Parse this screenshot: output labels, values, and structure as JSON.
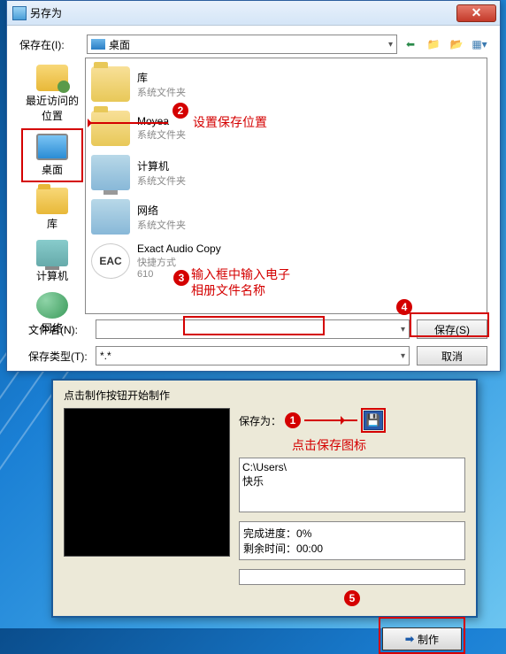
{
  "dialog": {
    "title": "另存为",
    "save_in_label": "保存在(I):",
    "location": "桌面",
    "places": [
      {
        "label": "最近访问的位置"
      },
      {
        "label": "桌面"
      },
      {
        "label": "库"
      },
      {
        "label": "计算机"
      },
      {
        "label": "网络"
      }
    ],
    "items": [
      {
        "name": "库",
        "type": "系统文件夹"
      },
      {
        "name": "Moyea",
        "type": "系统文件夹"
      },
      {
        "name": "计算机",
        "type": "系统文件夹"
      },
      {
        "name": "网络",
        "type": "系统文件夹"
      },
      {
        "name": "Exact Audio Copy",
        "type": "快捷方式",
        "size": "610"
      }
    ],
    "filename_label": "文件名(N):",
    "filename_value": "",
    "filetype_label": "保存类型(T):",
    "filetype_value": "*.*",
    "save_btn": "保存(S)",
    "cancel_btn": "取消"
  },
  "annotations": {
    "a1": "点击保存图标",
    "a2": "设置保存位置",
    "a3_line1": "输入框中输入电子",
    "a3_line2": "相册文件名称",
    "eac": "EAC"
  },
  "lower": {
    "title": "点击制作按钮开始制作",
    "saveas_label": "保存为：",
    "path_line1": "C:\\Users\\",
    "path_line2": "快乐",
    "progress_label": "完成进度：",
    "progress_value": "0%",
    "remain_label": "剩余时间：",
    "remain_value": "00:00",
    "make_btn": "制作"
  }
}
